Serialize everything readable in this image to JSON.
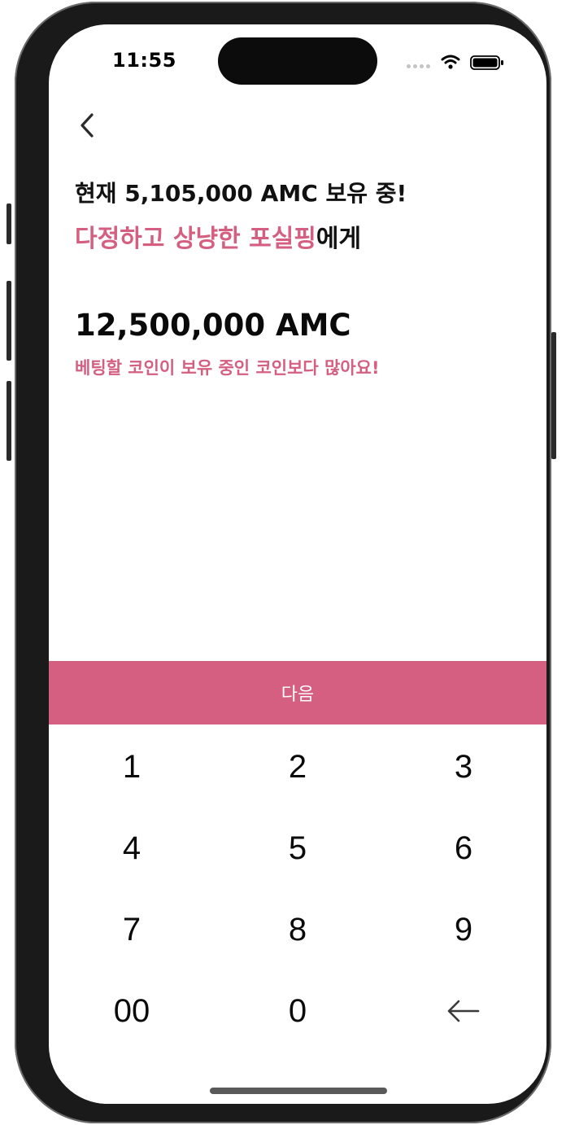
{
  "status_bar": {
    "time": "11:55"
  },
  "header": {
    "back_icon": "chevron-left-icon"
  },
  "bet": {
    "balance_text": "현재 5,105,000 AMC 보유 중!",
    "recipient_name": "다정하고 상냥한 포실핑",
    "recipient_suffix": "에게",
    "amount_text": "12,500,000 AMC",
    "warning_text": "베팅할 코인이 보유 중인 코인보다 많아요!"
  },
  "next_button": {
    "label": "다음"
  },
  "keypad": {
    "keys": [
      "1",
      "2",
      "3",
      "4",
      "5",
      "6",
      "7",
      "8",
      "9",
      "00",
      "0"
    ],
    "backspace_icon": "backspace-arrow-icon"
  },
  "colors": {
    "accent": "#d45f80",
    "text": "#111111",
    "background": "#ffffff"
  }
}
